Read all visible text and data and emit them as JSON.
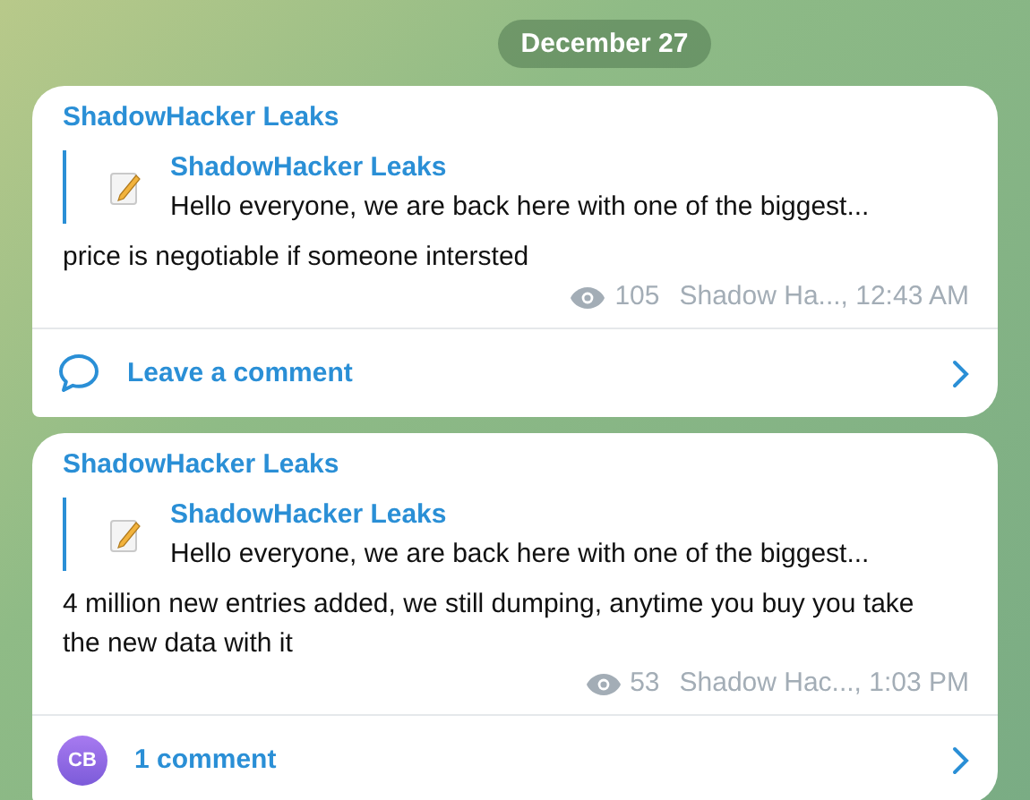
{
  "date_badge": "December 27",
  "messages": [
    {
      "channel": "ShadowHacker Leaks",
      "reply": {
        "author": "ShadowHacker Leaks",
        "text": "Hello everyone, we are back here with one of the biggest..."
      },
      "text": "price is negotiable if someone intersted",
      "views": "105",
      "signature": "Shadow Ha..., 12:43 AM",
      "footer": {
        "kind": "leave",
        "label": "Leave a comment"
      }
    },
    {
      "channel": "ShadowHacker Leaks",
      "reply": {
        "author": "ShadowHacker Leaks",
        "text": "Hello everyone, we are back here with one of the biggest..."
      },
      "text": "4 million new entries added, we still dumping, anytime you buy you take the new data with it",
      "views": "53",
      "signature": "Shadow Hac..., 1:03 PM",
      "footer": {
        "kind": "comments",
        "label": "1 comment",
        "avatar": "CB"
      }
    }
  ]
}
